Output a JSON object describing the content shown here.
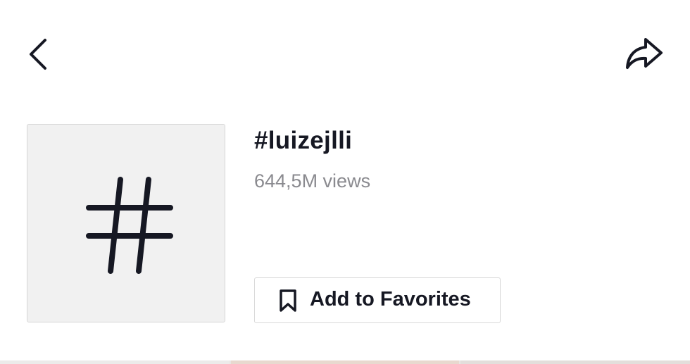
{
  "header": {
    "back_icon": "chevron-left-icon",
    "share_icon": "share-arrow-icon"
  },
  "hashtag": {
    "tile_icon": "hashtag-icon",
    "title": "#luizejlli",
    "views": "644,5M views"
  },
  "favorites": {
    "icon": "bookmark-icon",
    "label": "Add to Favorites"
  },
  "colors": {
    "text_primary": "#161823",
    "text_secondary": "#8a8a8f",
    "tile_background": "#f1f1f1",
    "border": "#d9d9d9"
  }
}
